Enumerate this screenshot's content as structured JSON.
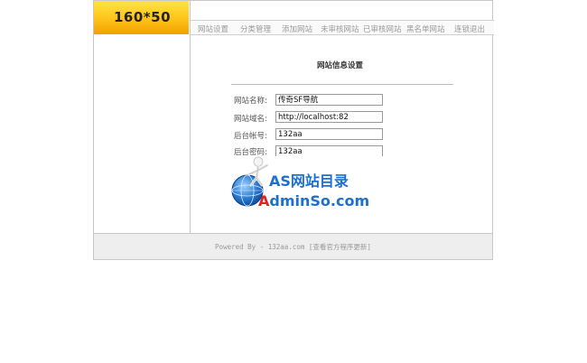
{
  "logo": {
    "text": "160*50"
  },
  "nav": {
    "items": [
      {
        "label": "网站设置"
      },
      {
        "label": "分类管理"
      },
      {
        "label": "添加网站"
      },
      {
        "label": "未审核网站"
      },
      {
        "label": "已审核网站"
      },
      {
        "label": "黑名单网站"
      },
      {
        "label": "连锁退出"
      }
    ]
  },
  "content": {
    "title": "网站信息设置",
    "fields": [
      {
        "label": "网站名称:",
        "value": "传奇SF导航"
      },
      {
        "label": "网站域名:",
        "value": "http://localhost:82"
      },
      {
        "label": "后台帐号:",
        "value": "132aa"
      },
      {
        "label": "后台密码:",
        "value": "132aa"
      }
    ]
  },
  "watermark": {
    "line1": "AS网站目录",
    "line2_red": "A",
    "line2_rest": "dminSo.com"
  },
  "footer": {
    "text": "Powered By - 132aa.com [查看官方程序更新]"
  }
}
